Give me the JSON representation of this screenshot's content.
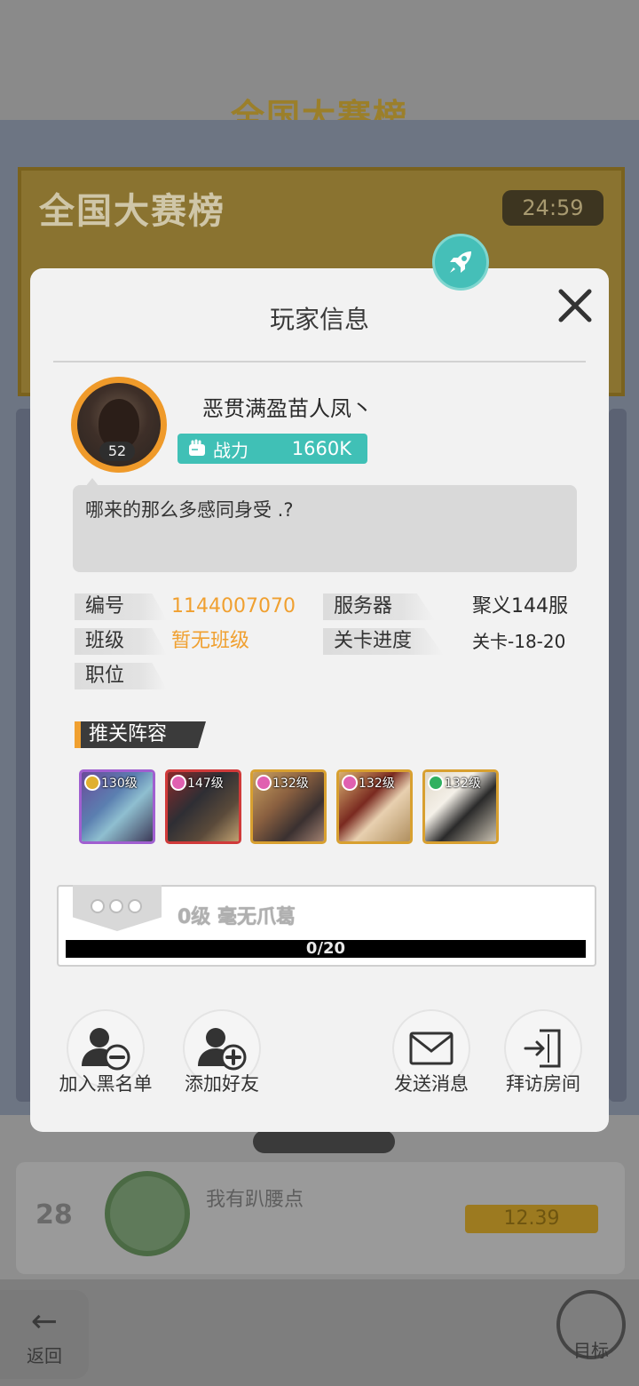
{
  "background": {
    "header_title": "全国大赛榜",
    "banner_title": "全国大赛榜",
    "banner_timer": "24:59",
    "rank_number": "28",
    "rank_name": "我有趴腰点",
    "rank_score": "12.39",
    "back_label": "返回",
    "goal_label": "目标"
  },
  "dialog": {
    "title": "玩家信息",
    "player": {
      "name": "恶贯满盈苗人凤丶",
      "avatar_level": "52",
      "power_label": "战力",
      "power_value": "1660K",
      "signature": "哪来的那么多感同身受 .?"
    },
    "info": {
      "id_label": "编号",
      "id_value": "1144007070",
      "server_label": "服务器",
      "server_value": "聚义144服",
      "class_label": "班级",
      "class_value": "暂无班级",
      "stage_label": "关卡进度",
      "stage_value": "关卡-18-20",
      "position_label": "职位"
    },
    "lineup": {
      "title": "推关阵容",
      "heroes": [
        {
          "level": "130级"
        },
        {
          "level": "147级"
        },
        {
          "level": "132级"
        },
        {
          "level": "132级"
        },
        {
          "level": "132级"
        }
      ]
    },
    "rank_title": {
      "text": "0级 毫无爪葛",
      "progress_text": "0/20",
      "progress_fraction": 0
    },
    "actions": {
      "blacklist": "加入黑名单",
      "add_friend": "添加好友",
      "send_message": "发送消息",
      "visit_room": "拜访房间"
    }
  },
  "colors": {
    "accent_teal": "#40c0b6",
    "accent_orange": "#f0a030"
  }
}
